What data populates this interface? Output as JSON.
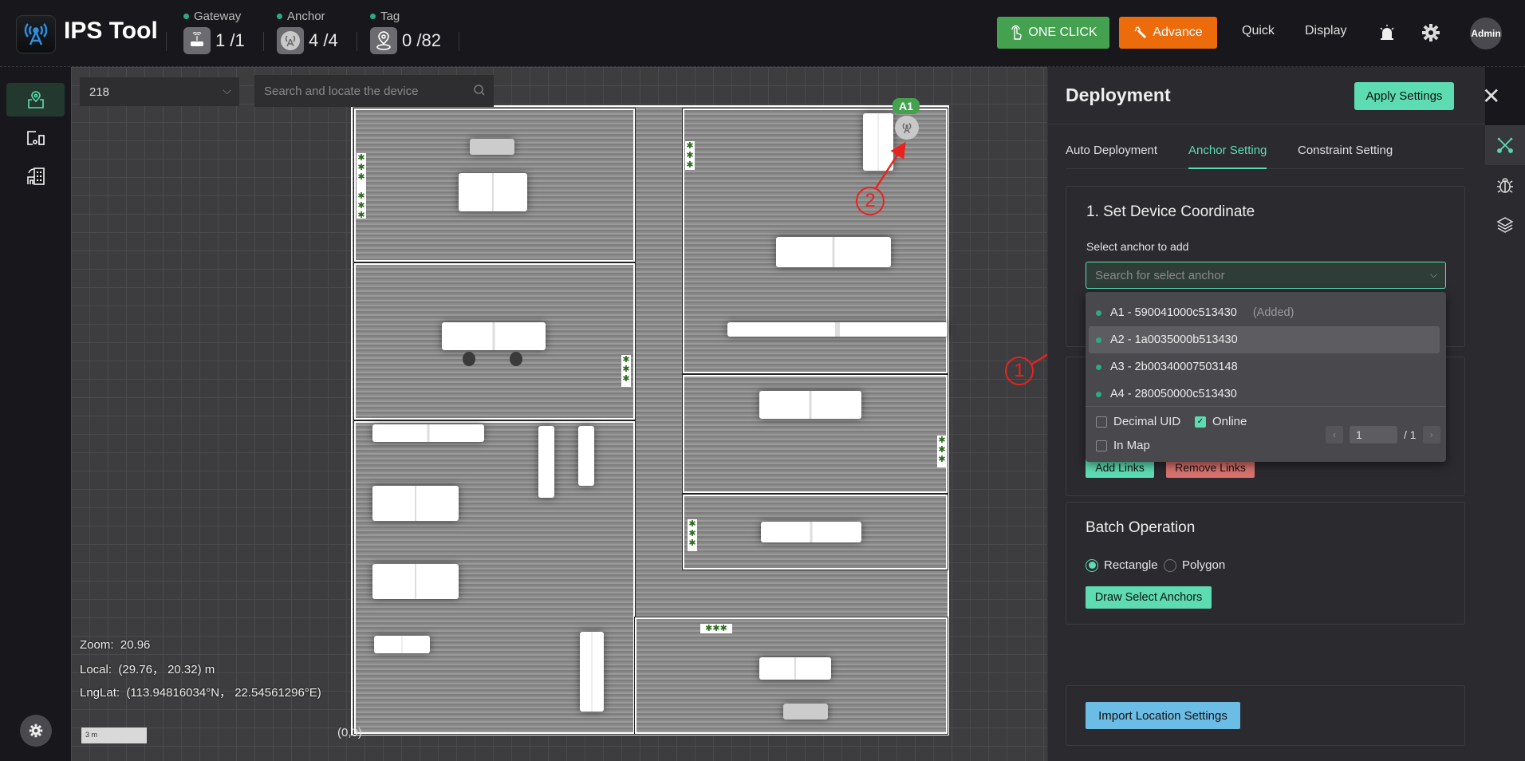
{
  "app": {
    "title": "IPS Tool",
    "logo_icon": "antenna-tower-icon"
  },
  "header": {
    "stats": [
      {
        "label": "Gateway",
        "value": "1 /1",
        "icon": "gateway-router-icon",
        "status_color": "#2fa887"
      },
      {
        "label": "Anchor",
        "value": "4 /4",
        "icon": "anchor-antenna-icon",
        "status_color": "#2fa887"
      },
      {
        "label": "Tag",
        "value": "0 /82",
        "icon": "tag-location-pin-icon",
        "status_color": "#2fa887"
      }
    ],
    "one_click_label": "ONE CLICK",
    "advance_label": "Advance",
    "quick_label": "Quick",
    "display_label": "Display",
    "alarm_icon": "alarm-siren-icon",
    "settings_icon": "gear-icon",
    "avatar_label": "Admin",
    "colors": {
      "one_click": "#43a14f",
      "advance": "#ec6c0c"
    }
  },
  "sidebar": {
    "items": [
      {
        "name": "map-location",
        "icon": "map-pin-icon",
        "active": true
      },
      {
        "name": "devices",
        "icon": "devices-icon",
        "active": false
      },
      {
        "name": "building",
        "icon": "building-icon",
        "active": false
      }
    ],
    "settings_icon": "gear-icon"
  },
  "map": {
    "floor_value": "218",
    "search_placeholder": "Search and locate the device",
    "anchor_marker_label": "A1",
    "zoom_label": "Zoom:",
    "zoom_value": "20.96",
    "local_label": "Local:",
    "local_value": "(29.76， 20.32)  m",
    "lnglat_label": "LngLat:",
    "lnglat_value": "(113.94816034°N， 22.54561296°E)",
    "scale_label": "3 m",
    "origin_label": "(0,0)",
    "annotations": [
      "1",
      "2"
    ]
  },
  "panel": {
    "title": "Deployment",
    "apply_label": "Apply Settings",
    "tabs": [
      {
        "label": "Auto Deployment",
        "active": false
      },
      {
        "label": "Anchor Setting",
        "active": true
      },
      {
        "label": "Constraint Setting",
        "active": false
      }
    ],
    "section1": {
      "title": "1. Set Device Coordinate",
      "select_label": "Select anchor to add",
      "select_placeholder": "Search for select anchor"
    },
    "dropdown": {
      "options": [
        {
          "name": "A1 - 590041000c513430",
          "note": "(Added)",
          "online": true
        },
        {
          "name": "A2 - 1a0035000b513430",
          "note": "",
          "online": true,
          "hover": true
        },
        {
          "name": "A3 - 2b00340007503148",
          "note": "",
          "online": true
        },
        {
          "name": "A4 - 280050000c513430",
          "note": "",
          "online": true
        }
      ],
      "filters": [
        {
          "label": "Decimal UID",
          "checked": false
        },
        {
          "label": "Online",
          "checked": true
        },
        {
          "label": "In Map",
          "checked": false
        }
      ],
      "page_current": "1",
      "page_total": "/ 1"
    },
    "links": {
      "add_label": "Add Links",
      "remove_label": "Remove Links"
    },
    "batch": {
      "title": "Batch Operation",
      "modes": [
        {
          "label": "Rectangle",
          "selected": true
        },
        {
          "label": "Polygon",
          "selected": false
        }
      ],
      "draw_label": "Draw Select Anchors"
    },
    "import_label": "Import Location Settings",
    "rail_icons": [
      "tools-icon",
      "bug-icon",
      "layers-icon"
    ],
    "accent": "#5ddcb2"
  }
}
